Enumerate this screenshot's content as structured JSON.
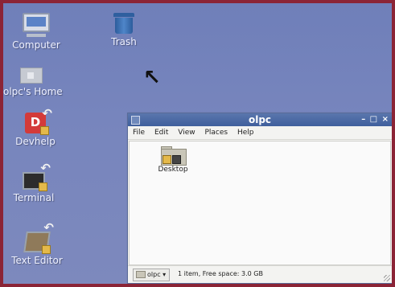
{
  "desktop": {
    "icons": [
      {
        "label": "Computer",
        "icon": "computer-icon"
      },
      {
        "label": "Trash",
        "icon": "trash-icon"
      },
      {
        "label": "olpc's Home",
        "icon": "home-folder-icon"
      },
      {
        "label": "Devhelp",
        "icon": "devhelp-icon"
      },
      {
        "label": "Terminal",
        "icon": "terminal-icon"
      },
      {
        "label": "Text Editor",
        "icon": "text-editor-icon"
      }
    ],
    "cursor": "↖",
    "devhelp_glyph": "D"
  },
  "window": {
    "title": "olpc",
    "controls": {
      "minimize": "–",
      "maximize": "□",
      "close": "×"
    },
    "menu": [
      "File",
      "Edit",
      "View",
      "Places",
      "Help"
    ],
    "files": [
      {
        "name": "Desktop",
        "icon": "folder-icon"
      }
    ],
    "status": {
      "location": "olpc ▾",
      "text": "1 item, Free space: 3.0 GB"
    }
  },
  "colors": {
    "frame": "#8b2436",
    "desktop": "#7785bd",
    "titlebar": "#4a67a3"
  }
}
